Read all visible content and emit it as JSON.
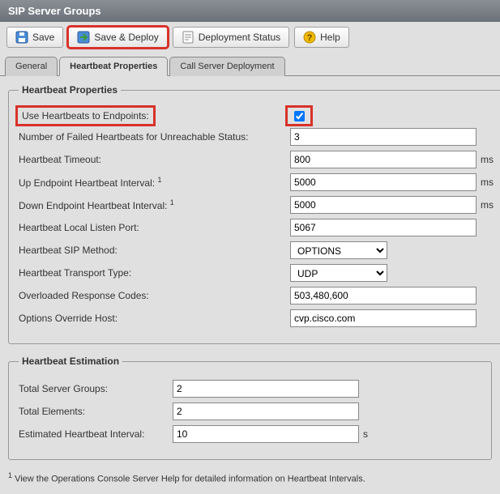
{
  "header": {
    "title": "SIP Server Groups"
  },
  "toolbar": {
    "save": "Save",
    "save_deploy": "Save & Deploy",
    "deploy_status": "Deployment Status",
    "help": "Help"
  },
  "tabs": {
    "general": "General",
    "heartbeat": "Heartbeat Properties",
    "call_server": "Call Server Deployment"
  },
  "hb_props": {
    "legend": "Heartbeat Properties",
    "use_hb_label": "Use Heartbeats to Endpoints:",
    "use_hb_checked": true,
    "failed_label": "Number of Failed Heartbeats for Unreachable Status:",
    "failed_val": "3",
    "timeout_label": "Heartbeat Timeout:",
    "timeout_val": "800",
    "up_label": "Up Endpoint Heartbeat Interval:",
    "up_sup": "1",
    "up_val": "5000",
    "down_label": "Down Endpoint Heartbeat Interval:",
    "down_sup": "1",
    "down_val": "5000",
    "port_label": "Heartbeat Local Listen Port:",
    "port_val": "5067",
    "method_label": "Heartbeat SIP Method:",
    "method_val": "OPTIONS",
    "transport_label": "Heartbeat Transport Type:",
    "transport_val": "UDP",
    "codes_label": "Overloaded Response Codes:",
    "codes_val": "503,480,600",
    "host_label": "Options Override Host:",
    "host_val": "cvp.cisco.com",
    "ms": "ms"
  },
  "hb_est": {
    "legend": "Heartbeat Estimation",
    "groups_label": "Total Server Groups:",
    "groups_val": "2",
    "elems_label": "Total Elements:",
    "elems_val": "2",
    "interval_label": "Estimated Heartbeat Interval:",
    "interval_val": "10",
    "s": "s"
  },
  "footnote": {
    "sup": "1",
    "text": " View the Operations Console Server Help for detailed information on Heartbeat Intervals."
  }
}
